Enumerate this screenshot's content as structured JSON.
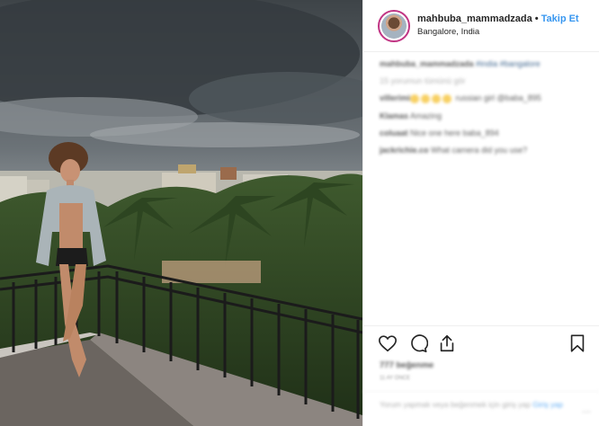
{
  "post": {
    "username": "mahbuba_mammadzada",
    "separator": "•",
    "follow_label": "Takip Et",
    "location": "Bangalore, India"
  },
  "comments": [
    {
      "user": "mahbuba_mammadzada",
      "text": " #india #bangalore"
    },
    {
      "user": "",
      "text": "15 yorumun tümünü gör"
    },
    {
      "user": "villerimi",
      "text": " russian girl @baba_895"
    },
    {
      "user": "Klamas",
      "text": " Amazing"
    },
    {
      "user": "coluaat",
      "text": " Nice one here baba_894"
    },
    {
      "user": "jackrichie.co",
      "text": " What camera did you use?"
    }
  ],
  "actions": {
    "likes": "777 beğenme",
    "time": "11 AY ÖNCE",
    "add_comment": "Yorum yapmak veya beğenmek için giriş yap",
    "login_link": "Giriş yap",
    "more": "..."
  },
  "icons": {
    "like": "heart-icon",
    "comment": "comment-icon",
    "share": "share-icon",
    "save": "bookmark-icon"
  },
  "colors": {
    "follow_blue": "#3897f0",
    "ring": "#c13584",
    "divider": "#efefef"
  }
}
